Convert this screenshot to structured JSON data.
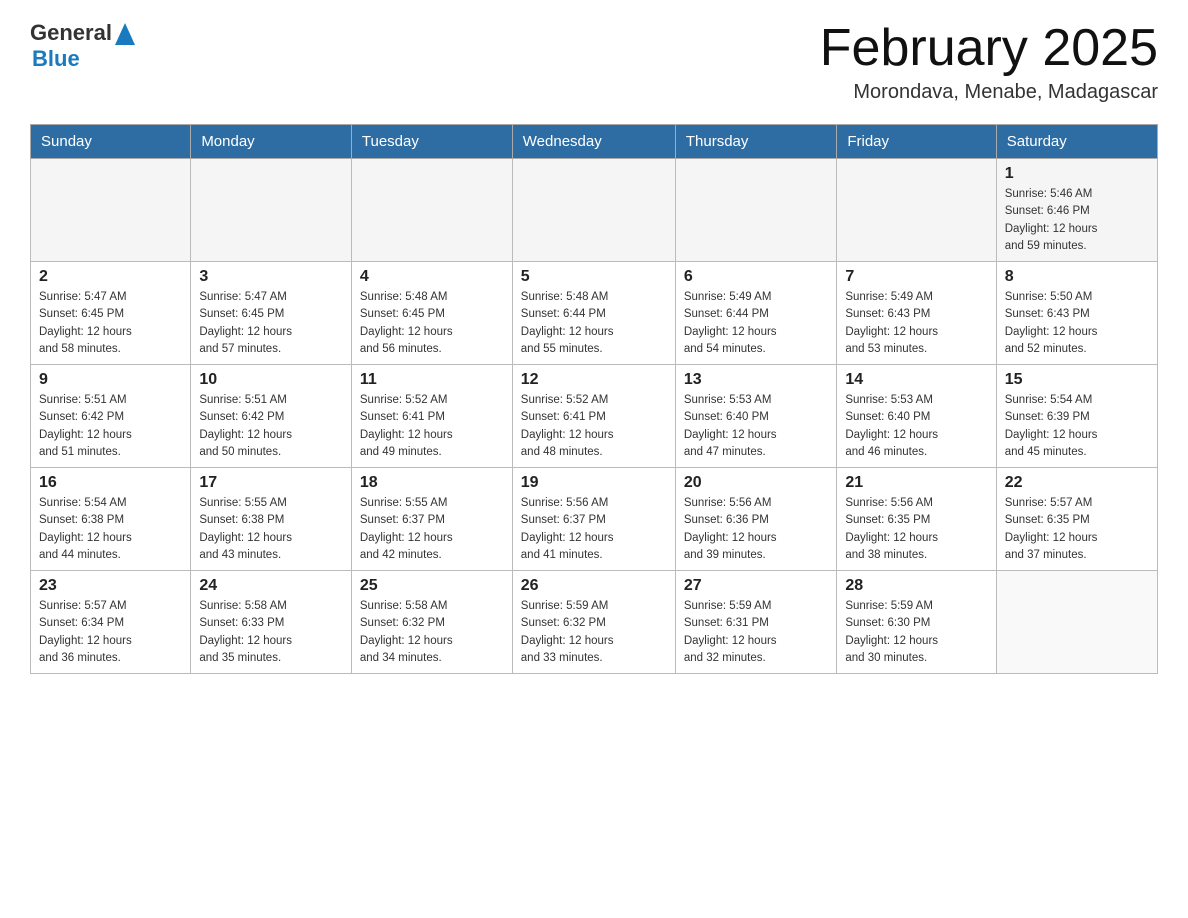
{
  "header": {
    "logo_general": "General",
    "logo_blue": "Blue",
    "month_title": "February 2025",
    "location": "Morondava, Menabe, Madagascar"
  },
  "days_of_week": [
    "Sunday",
    "Monday",
    "Tuesday",
    "Wednesday",
    "Thursday",
    "Friday",
    "Saturday"
  ],
  "weeks": [
    [
      {
        "day": "",
        "info": ""
      },
      {
        "day": "",
        "info": ""
      },
      {
        "day": "",
        "info": ""
      },
      {
        "day": "",
        "info": ""
      },
      {
        "day": "",
        "info": ""
      },
      {
        "day": "",
        "info": ""
      },
      {
        "day": "1",
        "info": "Sunrise: 5:46 AM\nSunset: 6:46 PM\nDaylight: 12 hours\nand 59 minutes."
      }
    ],
    [
      {
        "day": "2",
        "info": "Sunrise: 5:47 AM\nSunset: 6:45 PM\nDaylight: 12 hours\nand 58 minutes."
      },
      {
        "day": "3",
        "info": "Sunrise: 5:47 AM\nSunset: 6:45 PM\nDaylight: 12 hours\nand 57 minutes."
      },
      {
        "day": "4",
        "info": "Sunrise: 5:48 AM\nSunset: 6:45 PM\nDaylight: 12 hours\nand 56 minutes."
      },
      {
        "day": "5",
        "info": "Sunrise: 5:48 AM\nSunset: 6:44 PM\nDaylight: 12 hours\nand 55 minutes."
      },
      {
        "day": "6",
        "info": "Sunrise: 5:49 AM\nSunset: 6:44 PM\nDaylight: 12 hours\nand 54 minutes."
      },
      {
        "day": "7",
        "info": "Sunrise: 5:49 AM\nSunset: 6:43 PM\nDaylight: 12 hours\nand 53 minutes."
      },
      {
        "day": "8",
        "info": "Sunrise: 5:50 AM\nSunset: 6:43 PM\nDaylight: 12 hours\nand 52 minutes."
      }
    ],
    [
      {
        "day": "9",
        "info": "Sunrise: 5:51 AM\nSunset: 6:42 PM\nDaylight: 12 hours\nand 51 minutes."
      },
      {
        "day": "10",
        "info": "Sunrise: 5:51 AM\nSunset: 6:42 PM\nDaylight: 12 hours\nand 50 minutes."
      },
      {
        "day": "11",
        "info": "Sunrise: 5:52 AM\nSunset: 6:41 PM\nDaylight: 12 hours\nand 49 minutes."
      },
      {
        "day": "12",
        "info": "Sunrise: 5:52 AM\nSunset: 6:41 PM\nDaylight: 12 hours\nand 48 minutes."
      },
      {
        "day": "13",
        "info": "Sunrise: 5:53 AM\nSunset: 6:40 PM\nDaylight: 12 hours\nand 47 minutes."
      },
      {
        "day": "14",
        "info": "Sunrise: 5:53 AM\nSunset: 6:40 PM\nDaylight: 12 hours\nand 46 minutes."
      },
      {
        "day": "15",
        "info": "Sunrise: 5:54 AM\nSunset: 6:39 PM\nDaylight: 12 hours\nand 45 minutes."
      }
    ],
    [
      {
        "day": "16",
        "info": "Sunrise: 5:54 AM\nSunset: 6:38 PM\nDaylight: 12 hours\nand 44 minutes."
      },
      {
        "day": "17",
        "info": "Sunrise: 5:55 AM\nSunset: 6:38 PM\nDaylight: 12 hours\nand 43 minutes."
      },
      {
        "day": "18",
        "info": "Sunrise: 5:55 AM\nSunset: 6:37 PM\nDaylight: 12 hours\nand 42 minutes."
      },
      {
        "day": "19",
        "info": "Sunrise: 5:56 AM\nSunset: 6:37 PM\nDaylight: 12 hours\nand 41 minutes."
      },
      {
        "day": "20",
        "info": "Sunrise: 5:56 AM\nSunset: 6:36 PM\nDaylight: 12 hours\nand 39 minutes."
      },
      {
        "day": "21",
        "info": "Sunrise: 5:56 AM\nSunset: 6:35 PM\nDaylight: 12 hours\nand 38 minutes."
      },
      {
        "day": "22",
        "info": "Sunrise: 5:57 AM\nSunset: 6:35 PM\nDaylight: 12 hours\nand 37 minutes."
      }
    ],
    [
      {
        "day": "23",
        "info": "Sunrise: 5:57 AM\nSunset: 6:34 PM\nDaylight: 12 hours\nand 36 minutes."
      },
      {
        "day": "24",
        "info": "Sunrise: 5:58 AM\nSunset: 6:33 PM\nDaylight: 12 hours\nand 35 minutes."
      },
      {
        "day": "25",
        "info": "Sunrise: 5:58 AM\nSunset: 6:32 PM\nDaylight: 12 hours\nand 34 minutes."
      },
      {
        "day": "26",
        "info": "Sunrise: 5:59 AM\nSunset: 6:32 PM\nDaylight: 12 hours\nand 33 minutes."
      },
      {
        "day": "27",
        "info": "Sunrise: 5:59 AM\nSunset: 6:31 PM\nDaylight: 12 hours\nand 32 minutes."
      },
      {
        "day": "28",
        "info": "Sunrise: 5:59 AM\nSunset: 6:30 PM\nDaylight: 12 hours\nand 30 minutes."
      },
      {
        "day": "",
        "info": ""
      }
    ]
  ]
}
